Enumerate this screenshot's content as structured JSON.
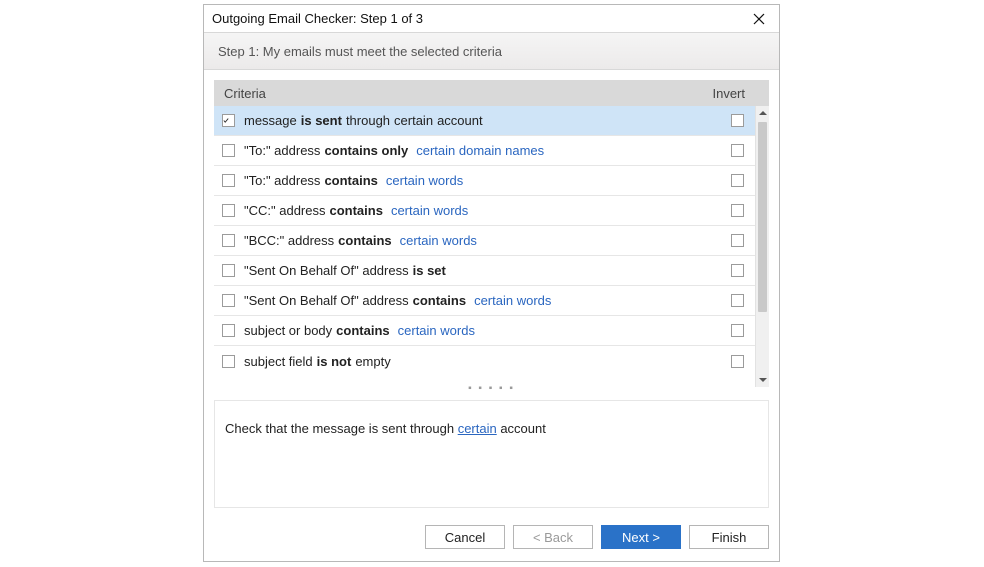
{
  "window": {
    "title": "Outgoing Email Checker: Step 1 of 3"
  },
  "step": {
    "description": "Step 1: My emails must meet the selected criteria"
  },
  "grid": {
    "header_criteria": "Criteria",
    "header_invert": "Invert"
  },
  "rows": [
    {
      "checked": true,
      "invert": false,
      "selected": true,
      "segments": [
        {
          "t": "message ",
          "b": false,
          "l": false
        },
        {
          "t": "is sent",
          "b": true,
          "l": false
        },
        {
          "t": " through ",
          "b": false,
          "l": false
        },
        {
          "t": " certain",
          "b": false,
          "l": false
        },
        {
          "t": "  account",
          "b": false,
          "l": false
        }
      ]
    },
    {
      "checked": false,
      "invert": false,
      "selected": false,
      "segments": [
        {
          "t": "\"To:\" address ",
          "b": false,
          "l": false
        },
        {
          "t": "contains only",
          "b": true,
          "l": false
        },
        {
          "t": "  ",
          "b": false,
          "l": false
        },
        {
          "t": "certain domain names",
          "b": false,
          "l": true
        }
      ]
    },
    {
      "checked": false,
      "invert": false,
      "selected": false,
      "segments": [
        {
          "t": "\"To:\" address ",
          "b": false,
          "l": false
        },
        {
          "t": "contains",
          "b": true,
          "l": false
        },
        {
          "t": "  ",
          "b": false,
          "l": false
        },
        {
          "t": "certain words",
          "b": false,
          "l": true
        }
      ]
    },
    {
      "checked": false,
      "invert": false,
      "selected": false,
      "segments": [
        {
          "t": "\"CC:\" address ",
          "b": false,
          "l": false
        },
        {
          "t": "contains",
          "b": true,
          "l": false
        },
        {
          "t": "  ",
          "b": false,
          "l": false
        },
        {
          "t": "certain words",
          "b": false,
          "l": true
        }
      ]
    },
    {
      "checked": false,
      "invert": false,
      "selected": false,
      "segments": [
        {
          "t": "\"BCC:\" address ",
          "b": false,
          "l": false
        },
        {
          "t": "contains",
          "b": true,
          "l": false
        },
        {
          "t": "  ",
          "b": false,
          "l": false
        },
        {
          "t": "certain words",
          "b": false,
          "l": true
        }
      ]
    },
    {
      "checked": false,
      "invert": false,
      "selected": false,
      "segments": [
        {
          "t": "\"Sent On Behalf Of\" address ",
          "b": false,
          "l": false
        },
        {
          "t": "is set",
          "b": true,
          "l": false
        }
      ]
    },
    {
      "checked": false,
      "invert": false,
      "selected": false,
      "segments": [
        {
          "t": "\"Sent On Behalf Of\" address ",
          "b": false,
          "l": false
        },
        {
          "t": "contains",
          "b": true,
          "l": false
        },
        {
          "t": "  ",
          "b": false,
          "l": false
        },
        {
          "t": "certain words",
          "b": false,
          "l": true
        }
      ]
    },
    {
      "checked": false,
      "invert": false,
      "selected": false,
      "segments": [
        {
          "t": "subject or body ",
          "b": false,
          "l": false
        },
        {
          "t": "contains",
          "b": true,
          "l": false
        },
        {
          "t": "  ",
          "b": false,
          "l": false
        },
        {
          "t": "certain words",
          "b": false,
          "l": true
        }
      ]
    },
    {
      "checked": false,
      "invert": false,
      "selected": false,
      "segments": [
        {
          "t": "subject field ",
          "b": false,
          "l": false
        },
        {
          "t": "is not",
          "b": true,
          "l": false
        },
        {
          "t": " empty",
          "b": false,
          "l": false
        }
      ]
    }
  ],
  "preview": {
    "before": "Check that the message is sent through ",
    "link": "certain",
    "after": " account"
  },
  "buttons": {
    "cancel": "Cancel",
    "back": "< Back",
    "next": "Next >",
    "finish": "Finish"
  }
}
